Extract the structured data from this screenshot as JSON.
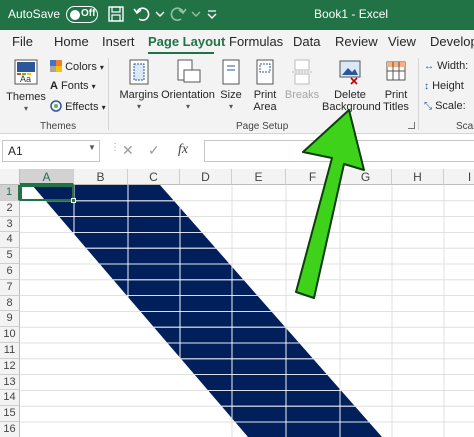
{
  "titlebar": {
    "autosave_label": "AutoSave",
    "autosave_state": "Off",
    "doc_title": "Book1  -  Excel"
  },
  "tabs": [
    {
      "label": "File"
    },
    {
      "label": "Home"
    },
    {
      "label": "Insert"
    },
    {
      "label": "Page Layout",
      "active": true
    },
    {
      "label": "Formulas"
    },
    {
      "label": "Data"
    },
    {
      "label": "Review"
    },
    {
      "label": "View"
    },
    {
      "label": "Develope"
    }
  ],
  "ribbon": {
    "themes": {
      "label": "Themes",
      "colors": "Colors",
      "fonts": "Fonts",
      "effects": "Effects",
      "group": "Themes"
    },
    "page_setup": {
      "margins": "Margins",
      "orientation": "Orientation",
      "size": "Size",
      "print_area_1": "Print",
      "print_area_2": "Area",
      "breaks": "Breaks",
      "delete_bg_1": "Delete",
      "delete_bg_2": "Background",
      "print_titles_1": "Print",
      "print_titles_2": "Titles",
      "group": "Page Setup"
    },
    "scale": {
      "width": "Width:",
      "height": "Height",
      "scale": "Scale:",
      "group": "Scal"
    }
  },
  "formula_bar": {
    "name_box": "A1",
    "fx": "fx",
    "value": ""
  },
  "grid": {
    "columns": [
      "A",
      "B",
      "C",
      "D",
      "E",
      "F",
      "G",
      "H",
      "I"
    ],
    "rows": [
      "1",
      "2",
      "3",
      "4",
      "5",
      "6",
      "7",
      "8",
      "9",
      "10",
      "11",
      "12",
      "13",
      "14",
      "15",
      "16"
    ],
    "selected_cell": "A1"
  },
  "colors": {
    "excel_green": "#217346",
    "background_fill": "#001F5B",
    "arrow_green": "#3FD21A"
  }
}
